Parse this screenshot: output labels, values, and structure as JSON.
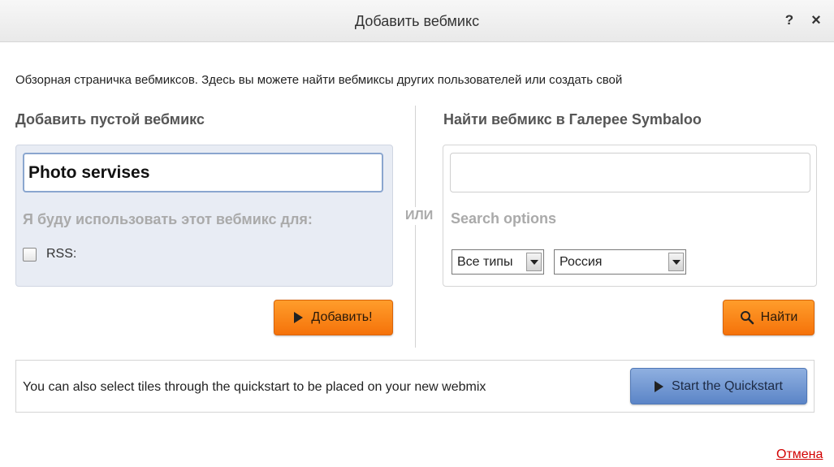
{
  "dialog": {
    "title": "Добавить вебмикс",
    "help_label": "?",
    "close_label": "×",
    "intro": "Обзорная страничка вебмиксов. Здесь вы можете найти вебмиксы других пользователей или создать свой"
  },
  "left": {
    "heading": "Добавить пустой вебмикс",
    "name_value": "Photo servises",
    "use_label": "Я буду использовать этот вебмикс для:",
    "rss_label": "RSS:",
    "rss_checked": false,
    "add_button": "Добавить!"
  },
  "or_label": "ИЛИ",
  "right": {
    "heading": "Найти вебмикс в Галерее Symbaloo",
    "search_value": "",
    "search_options_label": "Search options",
    "type_select": "Все типы",
    "country_select": "Россия",
    "find_button": "Найти"
  },
  "quickstart": {
    "text": "You can also select tiles through the quickstart to be placed on your new webmix",
    "button": "Start the Quickstart"
  },
  "cancel_link": "Отмена",
  "colors": {
    "accent_orange": "#f5720a",
    "quickstart_blue": "#5b85c7",
    "cancel_red": "#d20000"
  }
}
